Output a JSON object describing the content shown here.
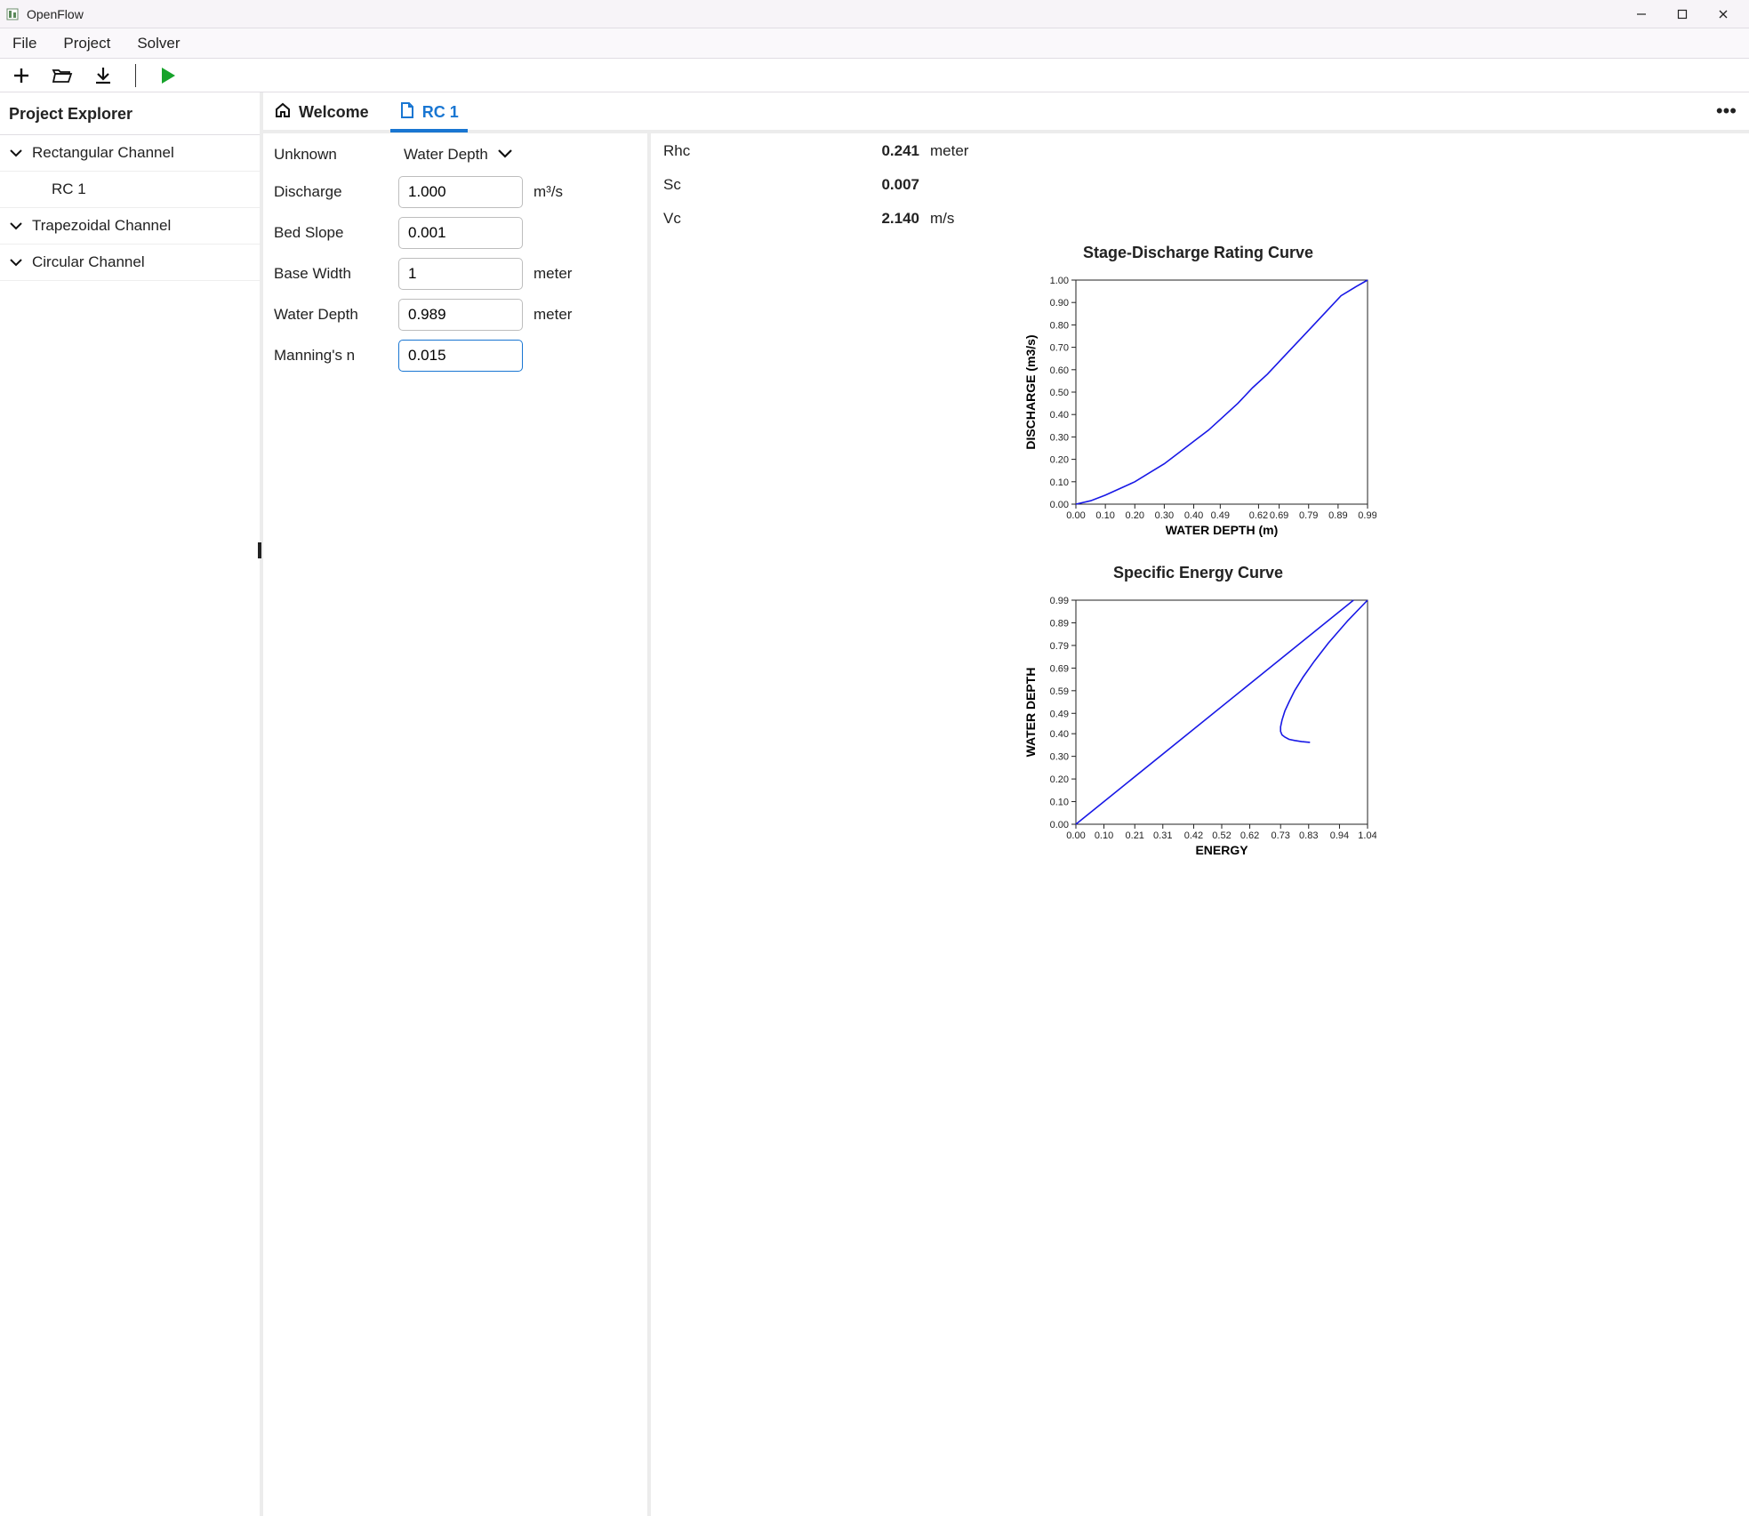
{
  "window": {
    "title": "OpenFlow"
  },
  "menu": {
    "file": "File",
    "project": "Project",
    "solver": "Solver"
  },
  "sidebar": {
    "title": "Project Explorer",
    "items": [
      {
        "label": "Rectangular Channel",
        "expanded": true
      },
      {
        "label": "RC 1",
        "child": true
      },
      {
        "label": "Trapezoidal Channel",
        "expanded": true
      },
      {
        "label": "Circular Channel",
        "expanded": true
      }
    ]
  },
  "tabs": {
    "welcome": "Welcome",
    "rc1": "RC 1"
  },
  "form": {
    "unknown_label": "Unknown",
    "unknown_value": "Water Depth",
    "rows": [
      {
        "label": "Discharge",
        "value": "1.000",
        "unit": "m³/s"
      },
      {
        "label": "Bed Slope",
        "value": "0.001",
        "unit": ""
      },
      {
        "label": "Base Width",
        "value": "1",
        "unit": "meter"
      },
      {
        "label": "Water Depth",
        "value": "0.989",
        "unit": "meter"
      },
      {
        "label": "Manning's n",
        "value": "0.015",
        "unit": "",
        "focused": true
      }
    ]
  },
  "results": {
    "rows": [
      {
        "label": "Rhc",
        "value": "0.241",
        "unit": "meter"
      },
      {
        "label": "Sc",
        "value": "0.007",
        "unit": ""
      },
      {
        "label": "Vc",
        "value": "2.140",
        "unit": "m/s"
      }
    ]
  },
  "chart_data": [
    {
      "type": "line",
      "title": "Stage-Discharge Rating Curve",
      "xlabel": "WATER DEPTH (m)",
      "ylabel": "DISCHARGE (m3/s)",
      "xlim": [
        0.0,
        0.99
      ],
      "ylim": [
        0.0,
        1.0
      ],
      "xticks": [
        0.0,
        0.1,
        0.2,
        0.3,
        0.4,
        0.49,
        0.62,
        0.69,
        0.79,
        0.89,
        0.99
      ],
      "yticks": [
        0.0,
        0.1,
        0.2,
        0.3,
        0.4,
        0.5,
        0.6,
        0.7,
        0.8,
        0.9,
        1.0
      ],
      "series": [
        {
          "name": "discharge",
          "x": [
            0.0,
            0.05,
            0.1,
            0.15,
            0.2,
            0.25,
            0.3,
            0.35,
            0.4,
            0.45,
            0.5,
            0.55,
            0.6,
            0.65,
            0.7,
            0.75,
            0.8,
            0.85,
            0.9,
            0.95,
            0.99
          ],
          "y": [
            0.0,
            0.015,
            0.04,
            0.07,
            0.1,
            0.14,
            0.18,
            0.23,
            0.28,
            0.33,
            0.39,
            0.45,
            0.52,
            0.58,
            0.65,
            0.72,
            0.79,
            0.86,
            0.93,
            0.97,
            1.0
          ]
        }
      ]
    },
    {
      "type": "line",
      "title": "Specific Energy Curve",
      "xlabel": "ENERGY",
      "ylabel": "WATER DEPTH",
      "xlim": [
        0.0,
        1.04
      ],
      "ylim": [
        0.0,
        0.99
      ],
      "xticks": [
        0.0,
        0.1,
        0.21,
        0.31,
        0.42,
        0.52,
        0.62,
        0.73,
        0.83,
        0.94,
        1.04
      ],
      "yticks": [
        0.0,
        0.1,
        0.2,
        0.3,
        0.4,
        0.49,
        0.59,
        0.69,
        0.79,
        0.89,
        0.99
      ],
      "series": [
        {
          "name": "asymptote",
          "x": [
            0.0,
            0.99
          ],
          "y": [
            0.0,
            0.99
          ]
        },
        {
          "name": "energy",
          "x": [
            1.04,
            0.97,
            0.9,
            0.85,
            0.81,
            0.78,
            0.76,
            0.745,
            0.735,
            0.73,
            0.73,
            0.735,
            0.745,
            0.76,
            0.78,
            0.805,
            0.835
          ],
          "y": [
            0.99,
            0.9,
            0.8,
            0.72,
            0.65,
            0.59,
            0.54,
            0.5,
            0.46,
            0.43,
            0.41,
            0.395,
            0.385,
            0.375,
            0.37,
            0.365,
            0.362
          ]
        }
      ]
    }
  ]
}
